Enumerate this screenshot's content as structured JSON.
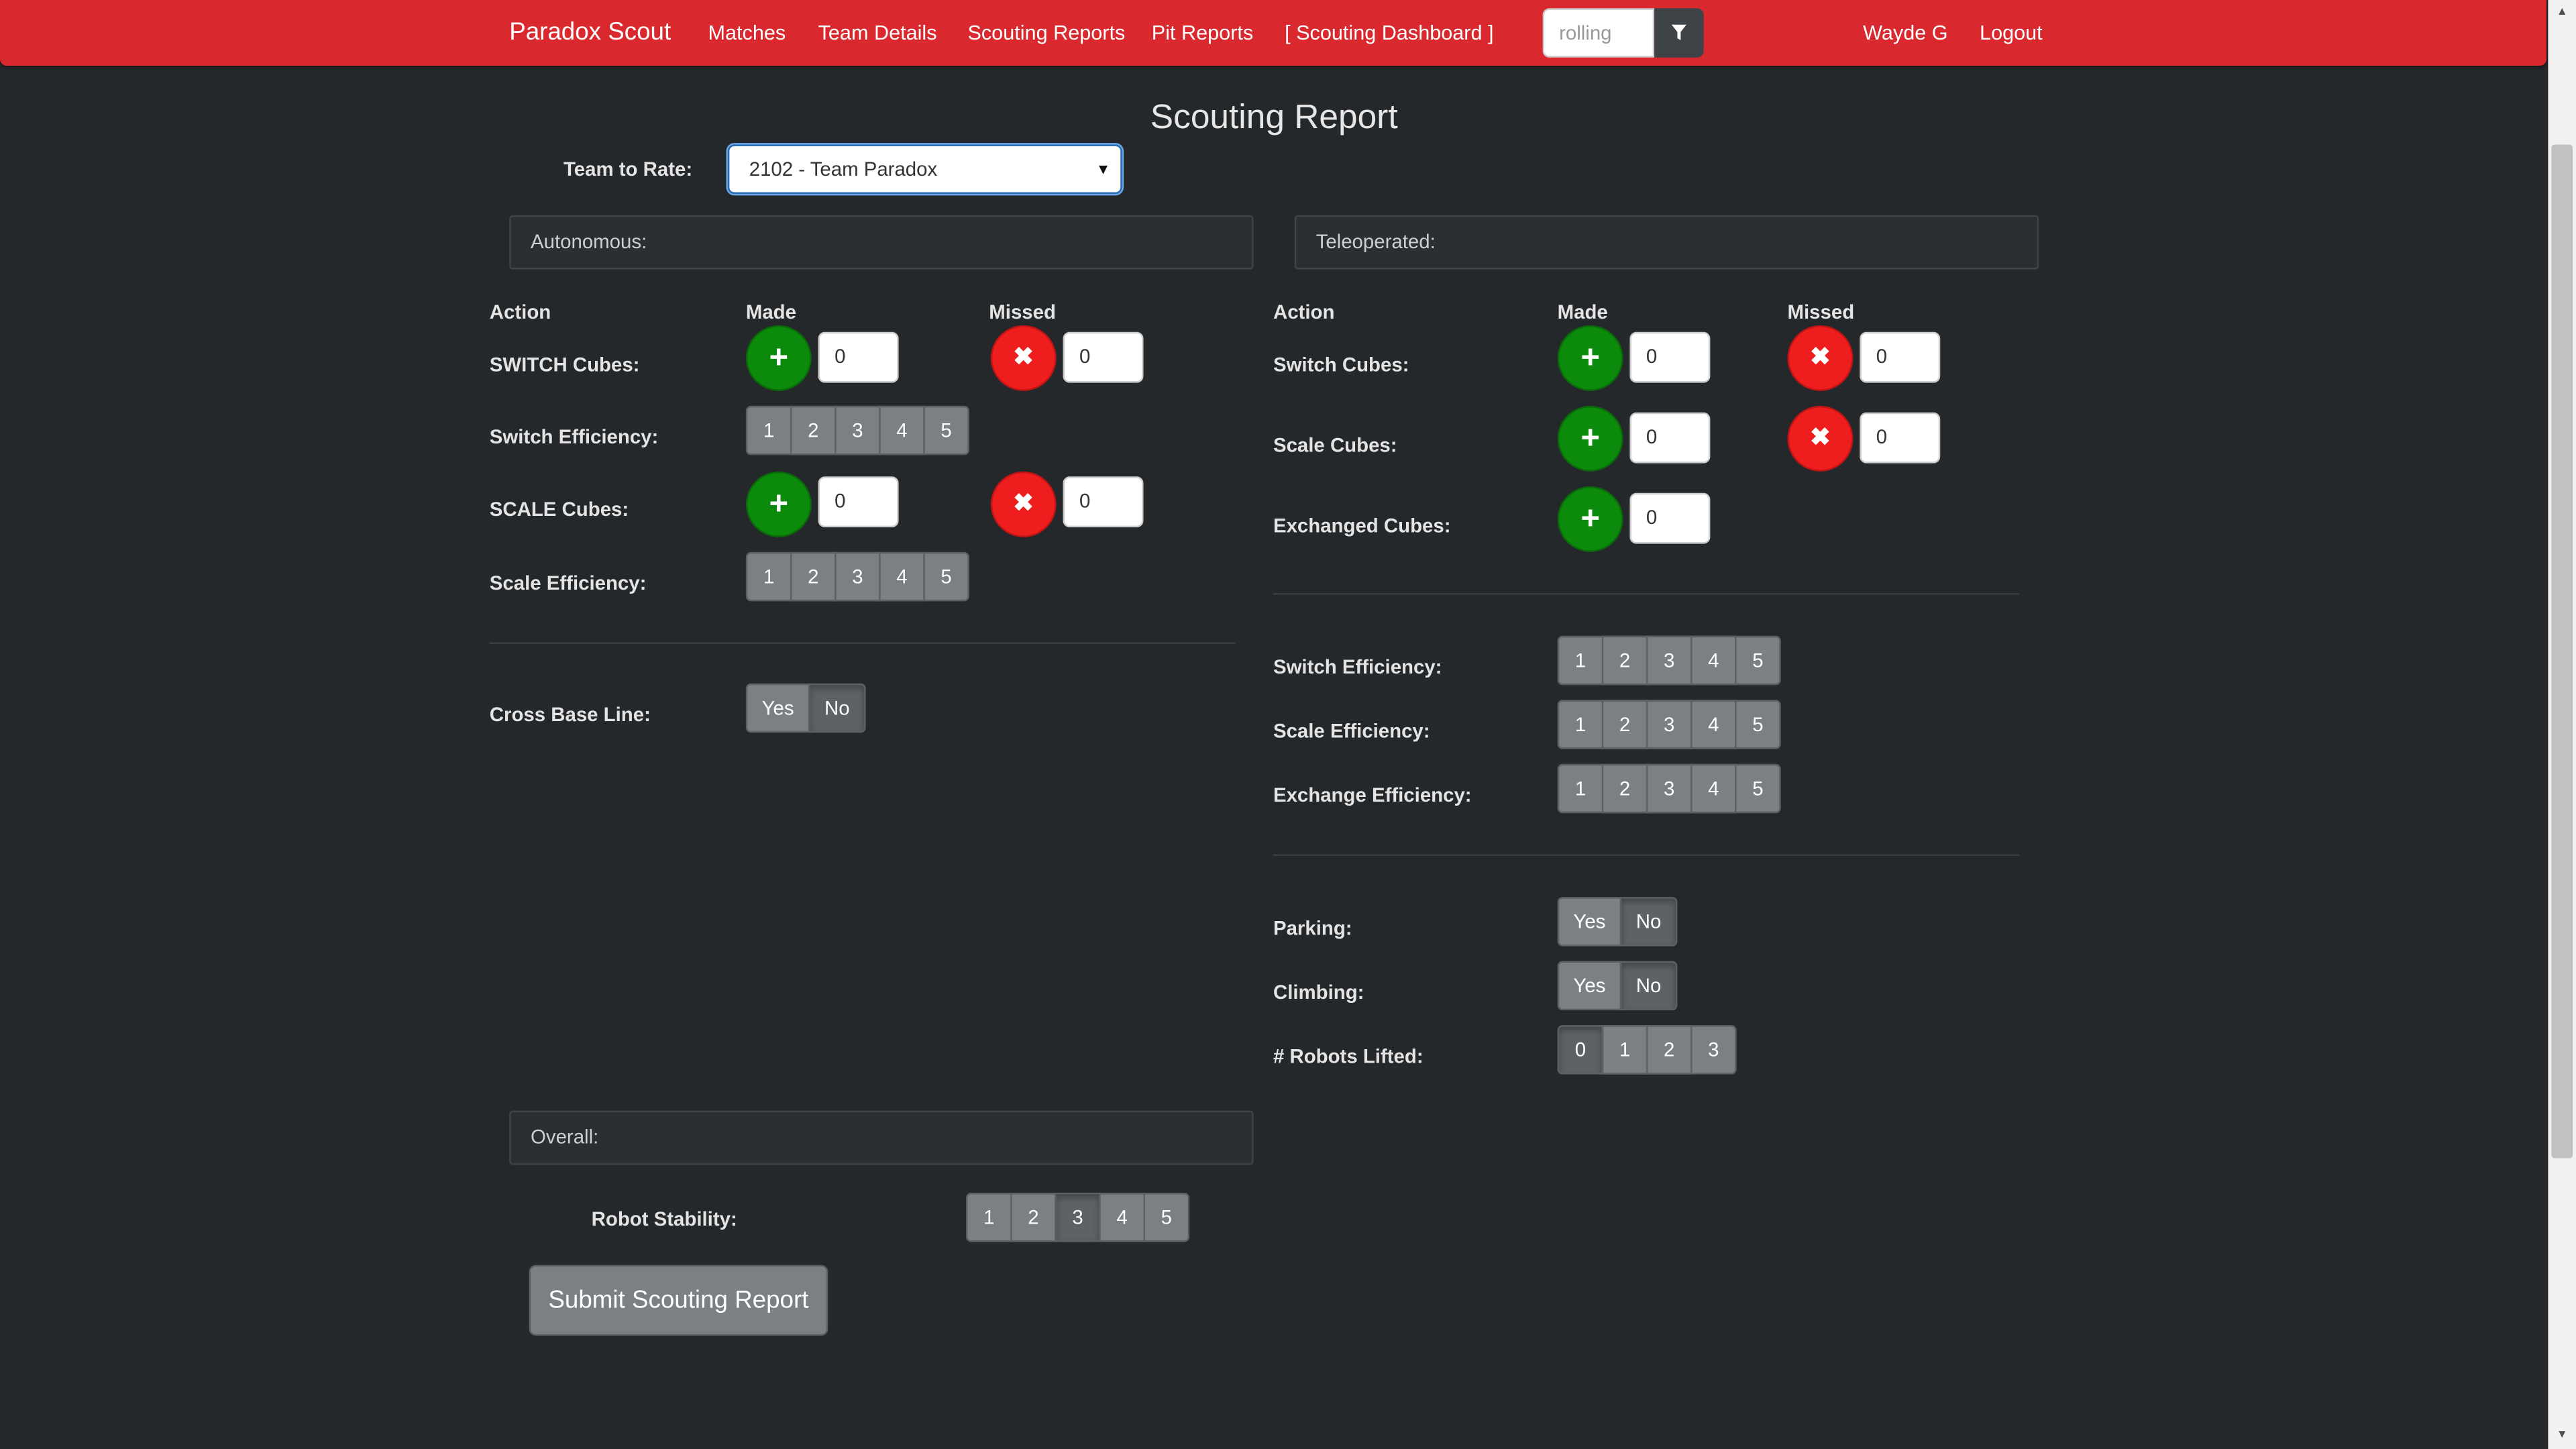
{
  "navbar": {
    "brand": "Paradox Scout",
    "links": [
      "Matches",
      "Team Details",
      "Scouting Reports",
      "Pit Reports",
      "[ Scouting Dashboard ]"
    ],
    "filter_value": "rolling",
    "user": "Wayde G",
    "logout": "Logout"
  },
  "page_title": "Scouting Report",
  "team_select": {
    "label": "Team to Rate:",
    "value": "2102 - Team Paradox"
  },
  "column_headers": {
    "action": "Action",
    "made": "Made",
    "missed": "Missed"
  },
  "autonomous": {
    "panel_title": "Autonomous:",
    "switch_cubes": {
      "label": "SWITCH Cubes:",
      "made": "0",
      "missed": "0"
    },
    "switch_efficiency": {
      "label": "Switch Efficiency:",
      "options": [
        "1",
        "2",
        "3",
        "4",
        "5"
      ]
    },
    "scale_cubes": {
      "label": "SCALE Cubes:",
      "made": "0",
      "missed": "0"
    },
    "scale_efficiency": {
      "label": "Scale Efficiency:",
      "options": [
        "1",
        "2",
        "3",
        "4",
        "5"
      ]
    },
    "cross_base_line": {
      "label": "Cross Base Line:",
      "options": [
        "Yes",
        "No"
      ],
      "selected": "No"
    }
  },
  "teleoperated": {
    "panel_title": "Teleoperated:",
    "switch_cubes": {
      "label": "Switch Cubes:",
      "made": "0",
      "missed": "0"
    },
    "scale_cubes": {
      "label": "Scale Cubes:",
      "made": "0",
      "missed": "0"
    },
    "exchanged_cubes": {
      "label": "Exchanged Cubes:",
      "made": "0"
    },
    "switch_efficiency": {
      "label": "Switch Efficiency:",
      "options": [
        "1",
        "2",
        "3",
        "4",
        "5"
      ]
    },
    "scale_efficiency": {
      "label": "Scale Efficiency:",
      "options": [
        "1",
        "2",
        "3",
        "4",
        "5"
      ]
    },
    "exchange_efficiency": {
      "label": "Exchange Efficiency:",
      "options": [
        "1",
        "2",
        "3",
        "4",
        "5"
      ]
    },
    "parking": {
      "label": "Parking:",
      "options": [
        "Yes",
        "No"
      ],
      "selected": "No"
    },
    "climbing": {
      "label": "Climbing:",
      "options": [
        "Yes",
        "No"
      ],
      "selected": "No"
    },
    "robots_lifted": {
      "label": "# Robots Lifted:",
      "options": [
        "0",
        "1",
        "2",
        "3"
      ],
      "selected": "0"
    }
  },
  "overall": {
    "panel_title": "Overall:",
    "robot_stability": {
      "label": "Robot Stability:",
      "options": [
        "1",
        "2",
        "3",
        "4",
        "5"
      ],
      "selected": "3"
    }
  },
  "submit_label": "Submit Scouting Report",
  "icons": {
    "plus": "plus-icon",
    "miss": "x-icon",
    "filter": "filter-icon",
    "dropdown": "caret-down-icon"
  },
  "colors": {
    "navbar": "#d9282e",
    "background": "#25282b",
    "made": "#0c8a0c",
    "missed": "#ef1e1e"
  }
}
